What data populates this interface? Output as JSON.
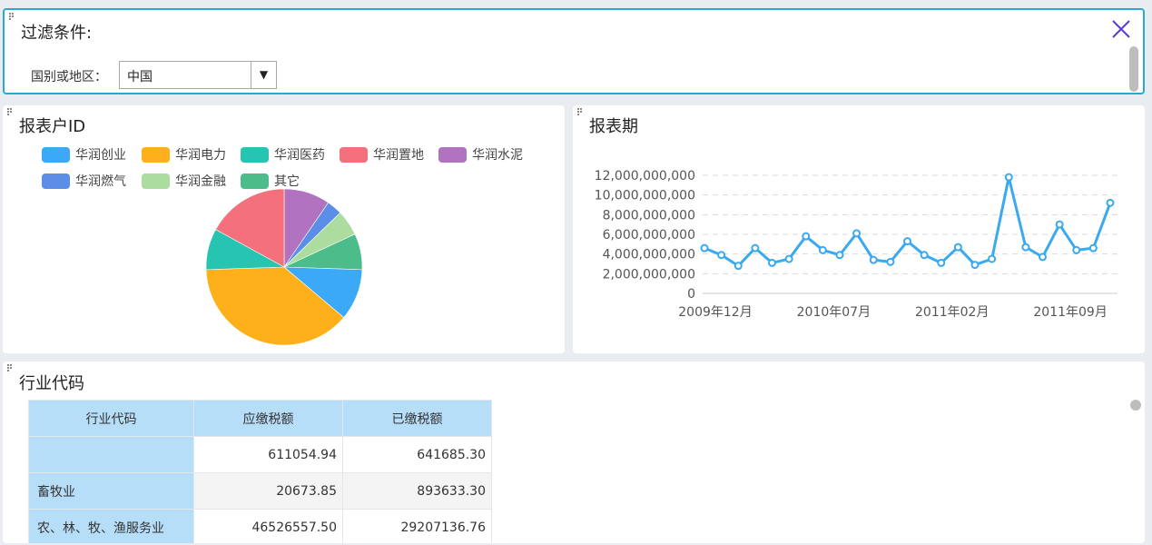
{
  "filter": {
    "title": "过滤条件:",
    "label": "国别或地区：",
    "selected": "中国",
    "arrow": "▼"
  },
  "pie_panel": {
    "title": "报表户ID"
  },
  "line_panel": {
    "title": "报表期"
  },
  "table_panel": {
    "title": "行业代码",
    "columns": [
      "行业代码",
      "应缴税额",
      "已缴税额"
    ],
    "rows": [
      {
        "code": "",
        "due": "611054.94",
        "paid": "641685.30"
      },
      {
        "code": "畜牧业",
        "due": "20673.85",
        "paid": "893633.30"
      },
      {
        "code": "农、林、牧、渔服务业",
        "due": "46526557.50",
        "paid": "29207136.76"
      }
    ]
  },
  "colors": {
    "accent": "#2aa7d8",
    "line": "#3aa9f0",
    "close": "#5b3bd6",
    "header_bg": "#b7def8"
  },
  "chart_data": [
    {
      "type": "pie",
      "title": "报表户ID",
      "legend_position": "top",
      "categories": [
        "华润创业",
        "华润电力",
        "华润医药",
        "华润置地",
        "华润水泥",
        "华润燃气",
        "华润金融",
        "其它"
      ],
      "colors": [
        "#3ba9f5",
        "#fdb01a",
        "#26c5b2",
        "#f4707d",
        "#b173bf",
        "#5b8ee6",
        "#acdc9e",
        "#4bbc8a"
      ],
      "values": [
        10,
        36,
        8,
        16,
        9,
        3,
        5,
        7
      ]
    },
    {
      "type": "line",
      "title": "报表期",
      "x": [
        "2009年12月",
        "2010年01月",
        "2010年02月",
        "2010年03月",
        "2010年04月",
        "2010年05月",
        "2010年06月",
        "2010年07月",
        "2010年08月",
        "2010年09月",
        "2010年10月",
        "2010年11月",
        "2010年12月",
        "2011年01月",
        "2011年02月",
        "2011年03月",
        "2011年04月",
        "2011年05月",
        "2011年06月",
        "2011年07月",
        "2011年08月",
        "2011年09月",
        "2011年10月",
        "2011年11月"
      ],
      "x_ticks": [
        "2009年12月",
        "2010年07月",
        "2011年02月",
        "2011年09月"
      ],
      "values": [
        4600000000,
        3900000000,
        2800000000,
        4600000000,
        3100000000,
        3500000000,
        5800000000,
        4400000000,
        3900000000,
        6100000000,
        3400000000,
        3200000000,
        5300000000,
        3900000000,
        3100000000,
        4700000000,
        2900000000,
        3500000000,
        11800000000,
        4700000000,
        3700000000,
        7000000000,
        4400000000,
        4600000000,
        9200000000
      ],
      "yticks": [
        "0",
        "2,000,000,000",
        "4,000,000,000",
        "6,000,000,000",
        "8,000,000,000",
        "10,000,000,000",
        "12,000,000,000"
      ],
      "ylim": [
        0,
        12000000000
      ],
      "grid": true
    }
  ]
}
